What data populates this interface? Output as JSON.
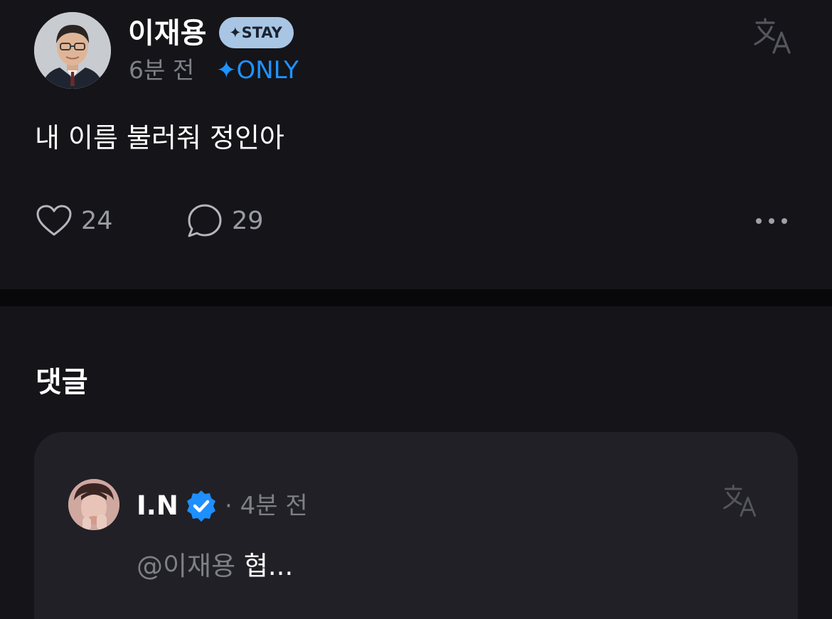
{
  "post": {
    "author": "이재용",
    "badge": "✦STAY",
    "time": "6분 전",
    "visibility": "✦ONLY",
    "body": "내 이름 불러줘 정인아",
    "likes": "24",
    "comments": "29"
  },
  "comments_section": {
    "heading": "댓글",
    "items": [
      {
        "author": "I.N",
        "time": "· 4분 전",
        "mention": "@이재용",
        "text": " 협..."
      }
    ]
  },
  "icons": {
    "translate": "translate-icon",
    "like": "heart-icon",
    "comment": "speech-bubble-icon",
    "more": "more-dots-icon",
    "verified": "verified-badge-icon"
  },
  "colors": {
    "background": "#141419",
    "card": "#202026",
    "accent": "#1e93ff",
    "badge": "#a8c6e4",
    "muted": "#7e7f87"
  }
}
